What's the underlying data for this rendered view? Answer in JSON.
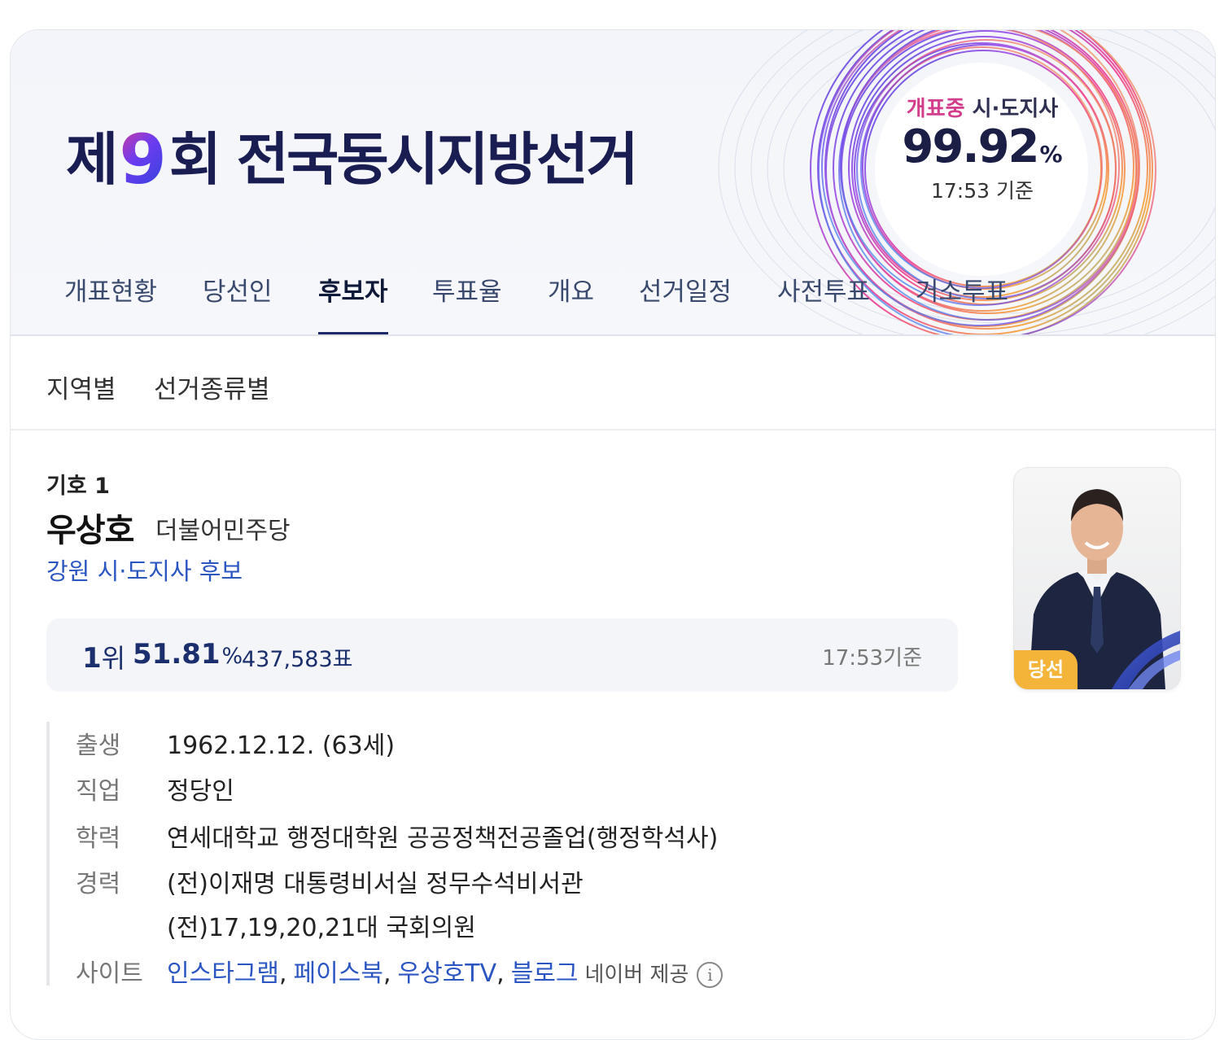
{
  "banner": {
    "title_pre": "제",
    "title_num": "9",
    "title_post": "회 전국동시지방선거",
    "status_label": "개표중",
    "election_type": "시·도지사",
    "percent": "99.92",
    "percent_unit": "%",
    "time_label": "17:53 기준"
  },
  "tabs": [
    "개표현황",
    "당선인",
    "후보자",
    "투표율",
    "개요",
    "선거일정",
    "사전투표",
    "거소투표"
  ],
  "active_tab": "후보자",
  "subtabs": [
    "지역별",
    "선거종류별"
  ],
  "candidate": {
    "number_label": "기호 1",
    "name": "우상호",
    "party": "더불어민주당",
    "position": "강원 시·도지사 후보",
    "rank": "1",
    "rank_unit": "위",
    "percent": "51.81",
    "percent_unit": "%",
    "votes": "437,583표",
    "time": "17:53기준",
    "badge": "당선"
  },
  "profile": {
    "birth_label": "출생",
    "birth_value": "1962.12.12. (63세)",
    "job_label": "직업",
    "job_value": "정당인",
    "edu_label": "학력",
    "edu_value": "연세대학교 행정대학원 공공정책전공졸업(행정학석사)",
    "career_label": "경력",
    "career_values": [
      "(전)이재명 대통령비서실 정무수석비서관",
      "(전)17,19,20,21대 국회의원"
    ],
    "site_label": "사이트",
    "sites": [
      "인스타그램",
      "페이스북",
      "우상호TV",
      "블로그"
    ],
    "site_separator": ",",
    "provider": "네이버 제공",
    "info_icon": "i"
  },
  "colors": {
    "title_navy": "#1a1d52",
    "status_pink": "#d23d8c",
    "link_blue": "#2b56c2",
    "win_gold": "#f4b43a",
    "tab_indicator": "#1c2a68"
  }
}
